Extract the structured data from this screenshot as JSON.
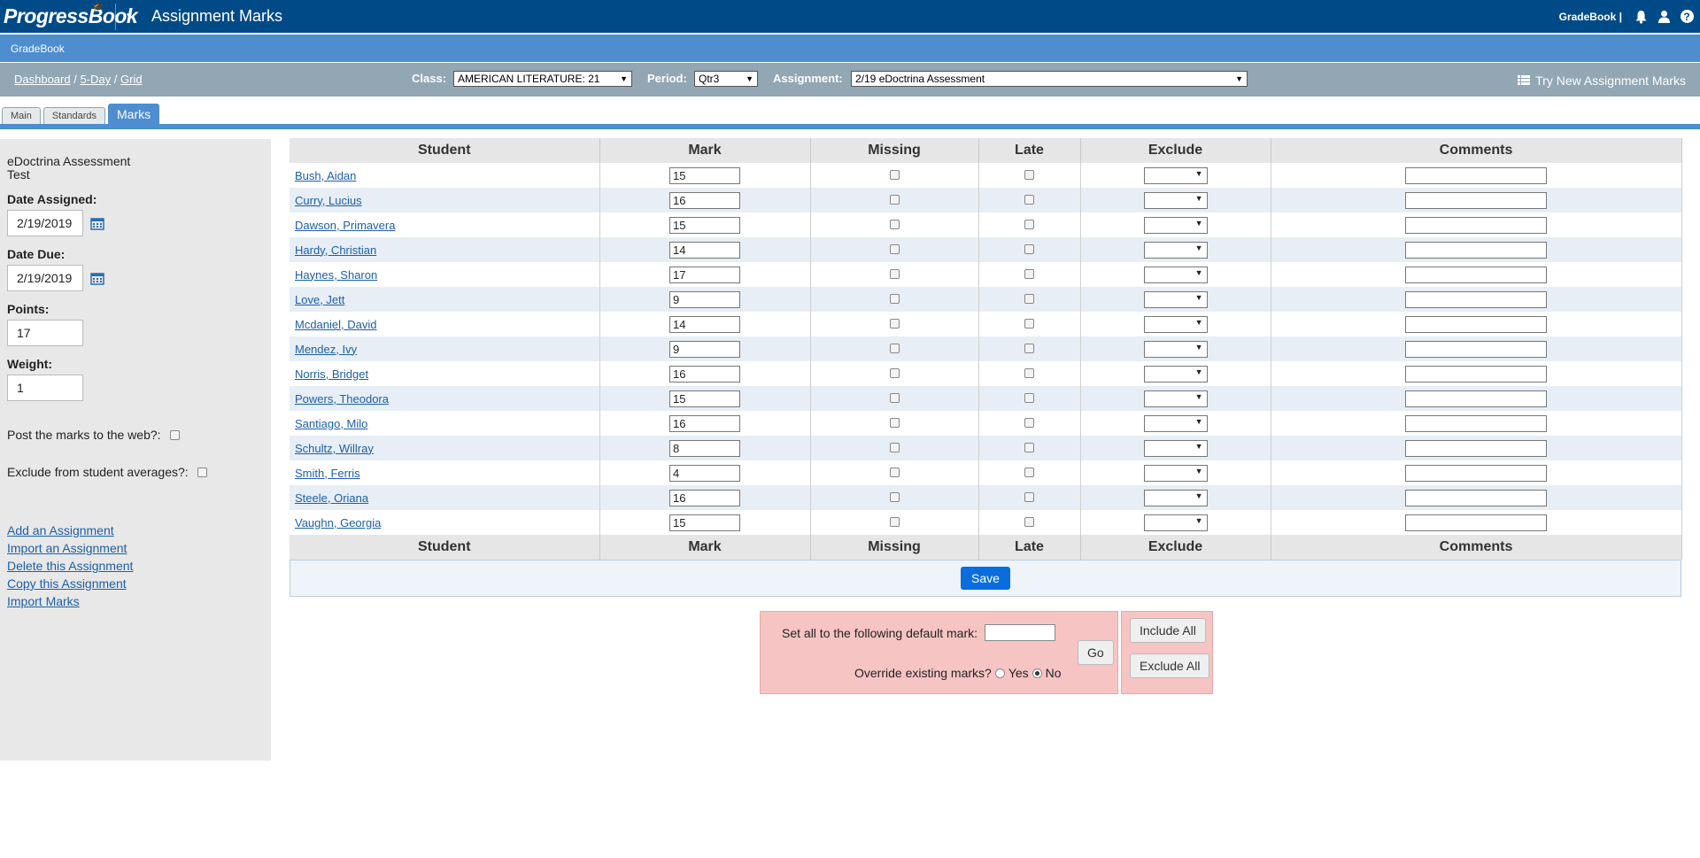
{
  "header": {
    "logo": "ProgressBook",
    "app_title": "Assignment Marks",
    "gradebook_link": "GradeBook |"
  },
  "subbar": {
    "label": "GradeBook"
  },
  "breadcrumb": {
    "dashboard": "Dashboard",
    "five_day": "5-Day",
    "grid": "Grid",
    "sep": "/"
  },
  "filters": {
    "class_label": "Class:",
    "class_value": "AMERICAN LITERATURE: 21",
    "period_label": "Period:",
    "period_value": "Qtr3",
    "assignment_label": "Assignment:",
    "assignment_value": "2/19 eDoctrina Assessment",
    "try_new": "Try New Assignment Marks"
  },
  "tabs": [
    {
      "label": "Main"
    },
    {
      "label": "Standards"
    },
    {
      "label": "Marks"
    }
  ],
  "left": {
    "assignment_name": "eDoctrina Assessment",
    "assignment_type": "Test",
    "date_assigned_label": "Date Assigned:",
    "date_assigned": "2/19/2019",
    "date_due_label": "Date Due:",
    "date_due": "2/19/2019",
    "points_label": "Points:",
    "points": "17",
    "weight_label": "Weight:",
    "weight": "1",
    "post_web_label": "Post the marks to the web?:",
    "exclude_avg_label": "Exclude from student averages?:",
    "links": [
      "Add an Assignment",
      "Import an Assignment",
      "Delete this Assignment",
      "Copy this Assignment",
      "Import Marks"
    ]
  },
  "table": {
    "columns": [
      "Student",
      "Mark",
      "Missing",
      "Late",
      "Exclude",
      "Comments"
    ],
    "rows": [
      {
        "student": "Bush, Aidan",
        "mark": "15"
      },
      {
        "student": "Curry, Lucius",
        "mark": "16"
      },
      {
        "student": "Dawson, Primavera",
        "mark": "15"
      },
      {
        "student": "Hardy, Christian",
        "mark": "14"
      },
      {
        "student": "Haynes, Sharon",
        "mark": "17"
      },
      {
        "student": "Love, Jett",
        "mark": "9"
      },
      {
        "student": "Mcdaniel, David",
        "mark": "14"
      },
      {
        "student": "Mendez, Ivy",
        "mark": "9"
      },
      {
        "student": "Norris, Bridget",
        "mark": "16"
      },
      {
        "student": "Powers, Theodora",
        "mark": "15"
      },
      {
        "student": "Santiago, Milo",
        "mark": "16"
      },
      {
        "student": "Schultz, Willray",
        "mark": "8"
      },
      {
        "student": "Smith, Ferris",
        "mark": "4"
      },
      {
        "student": "Steele, Oriana",
        "mark": "16"
      },
      {
        "student": "Vaughn, Georgia",
        "mark": "15"
      }
    ],
    "save_label": "Save"
  },
  "default_mark": {
    "set_all_label": "Set all to the following default mark:",
    "override_label": "Override existing marks?",
    "yes_label": "Yes",
    "no_label": "No",
    "go_label": "Go",
    "include_all": "Include All",
    "exclude_all": "Exclude All"
  }
}
